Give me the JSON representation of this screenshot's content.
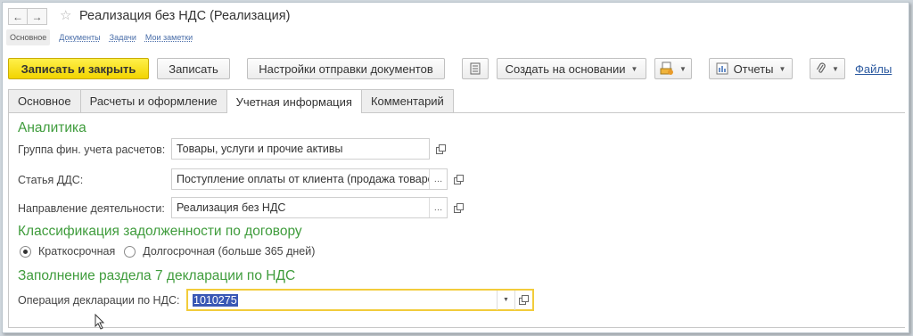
{
  "window": {
    "title": "Реализация без НДС (Реализация)",
    "back_icon": "arrow-left-icon",
    "forward_icon": "arrow-right-icon",
    "favorite_icon": "star-icon"
  },
  "subtabs": [
    {
      "label": "Основное",
      "active": true
    },
    {
      "label": "Документы",
      "active": false
    },
    {
      "label": "Задачи",
      "active": false
    },
    {
      "label": "Мои заметки",
      "active": false
    }
  ],
  "toolbar": {
    "save_close_label": "Записать и закрыть",
    "save_label": "Записать",
    "send_settings_label": "Настройки отправки документов",
    "create_based_label": "Создать на основании",
    "reports_label": "Отчеты",
    "files_label": "Файлы",
    "colors": {
      "primary": "#f5d800"
    }
  },
  "tabs": [
    {
      "label": "Основное",
      "active": false
    },
    {
      "label": "Расчеты и оформление",
      "active": false
    },
    {
      "label": "Учетная информация",
      "active": true
    },
    {
      "label": "Комментарий",
      "active": false
    }
  ],
  "analytics": {
    "heading": "Аналитика",
    "fin_group_label": "Группа фин. учета расчетов:",
    "fin_group_value": "Товары, услуги и прочие активы",
    "dds_label": "Статья ДДС:",
    "dds_value": "Поступление оплаты от клиента (продажа товаров, работ, услуг)",
    "direction_label": "Направление деятельности:",
    "direction_value": "Реализация без НДС"
  },
  "classification": {
    "heading": "Классификация задолженности по договору",
    "options": [
      {
        "label": "Краткосрочная",
        "selected": true
      },
      {
        "label": "Долгосрочная (больше 365 дней)",
        "selected": false
      }
    ]
  },
  "section7": {
    "heading": "Заполнение раздела 7 декларации по НДС",
    "operation_label": "Операция декларации по НДС:",
    "operation_value": "1010275"
  },
  "colors": {
    "section_heading": "#3f9c3c",
    "focus_border": "#f2cc3b",
    "selection": "#3a58b5"
  }
}
